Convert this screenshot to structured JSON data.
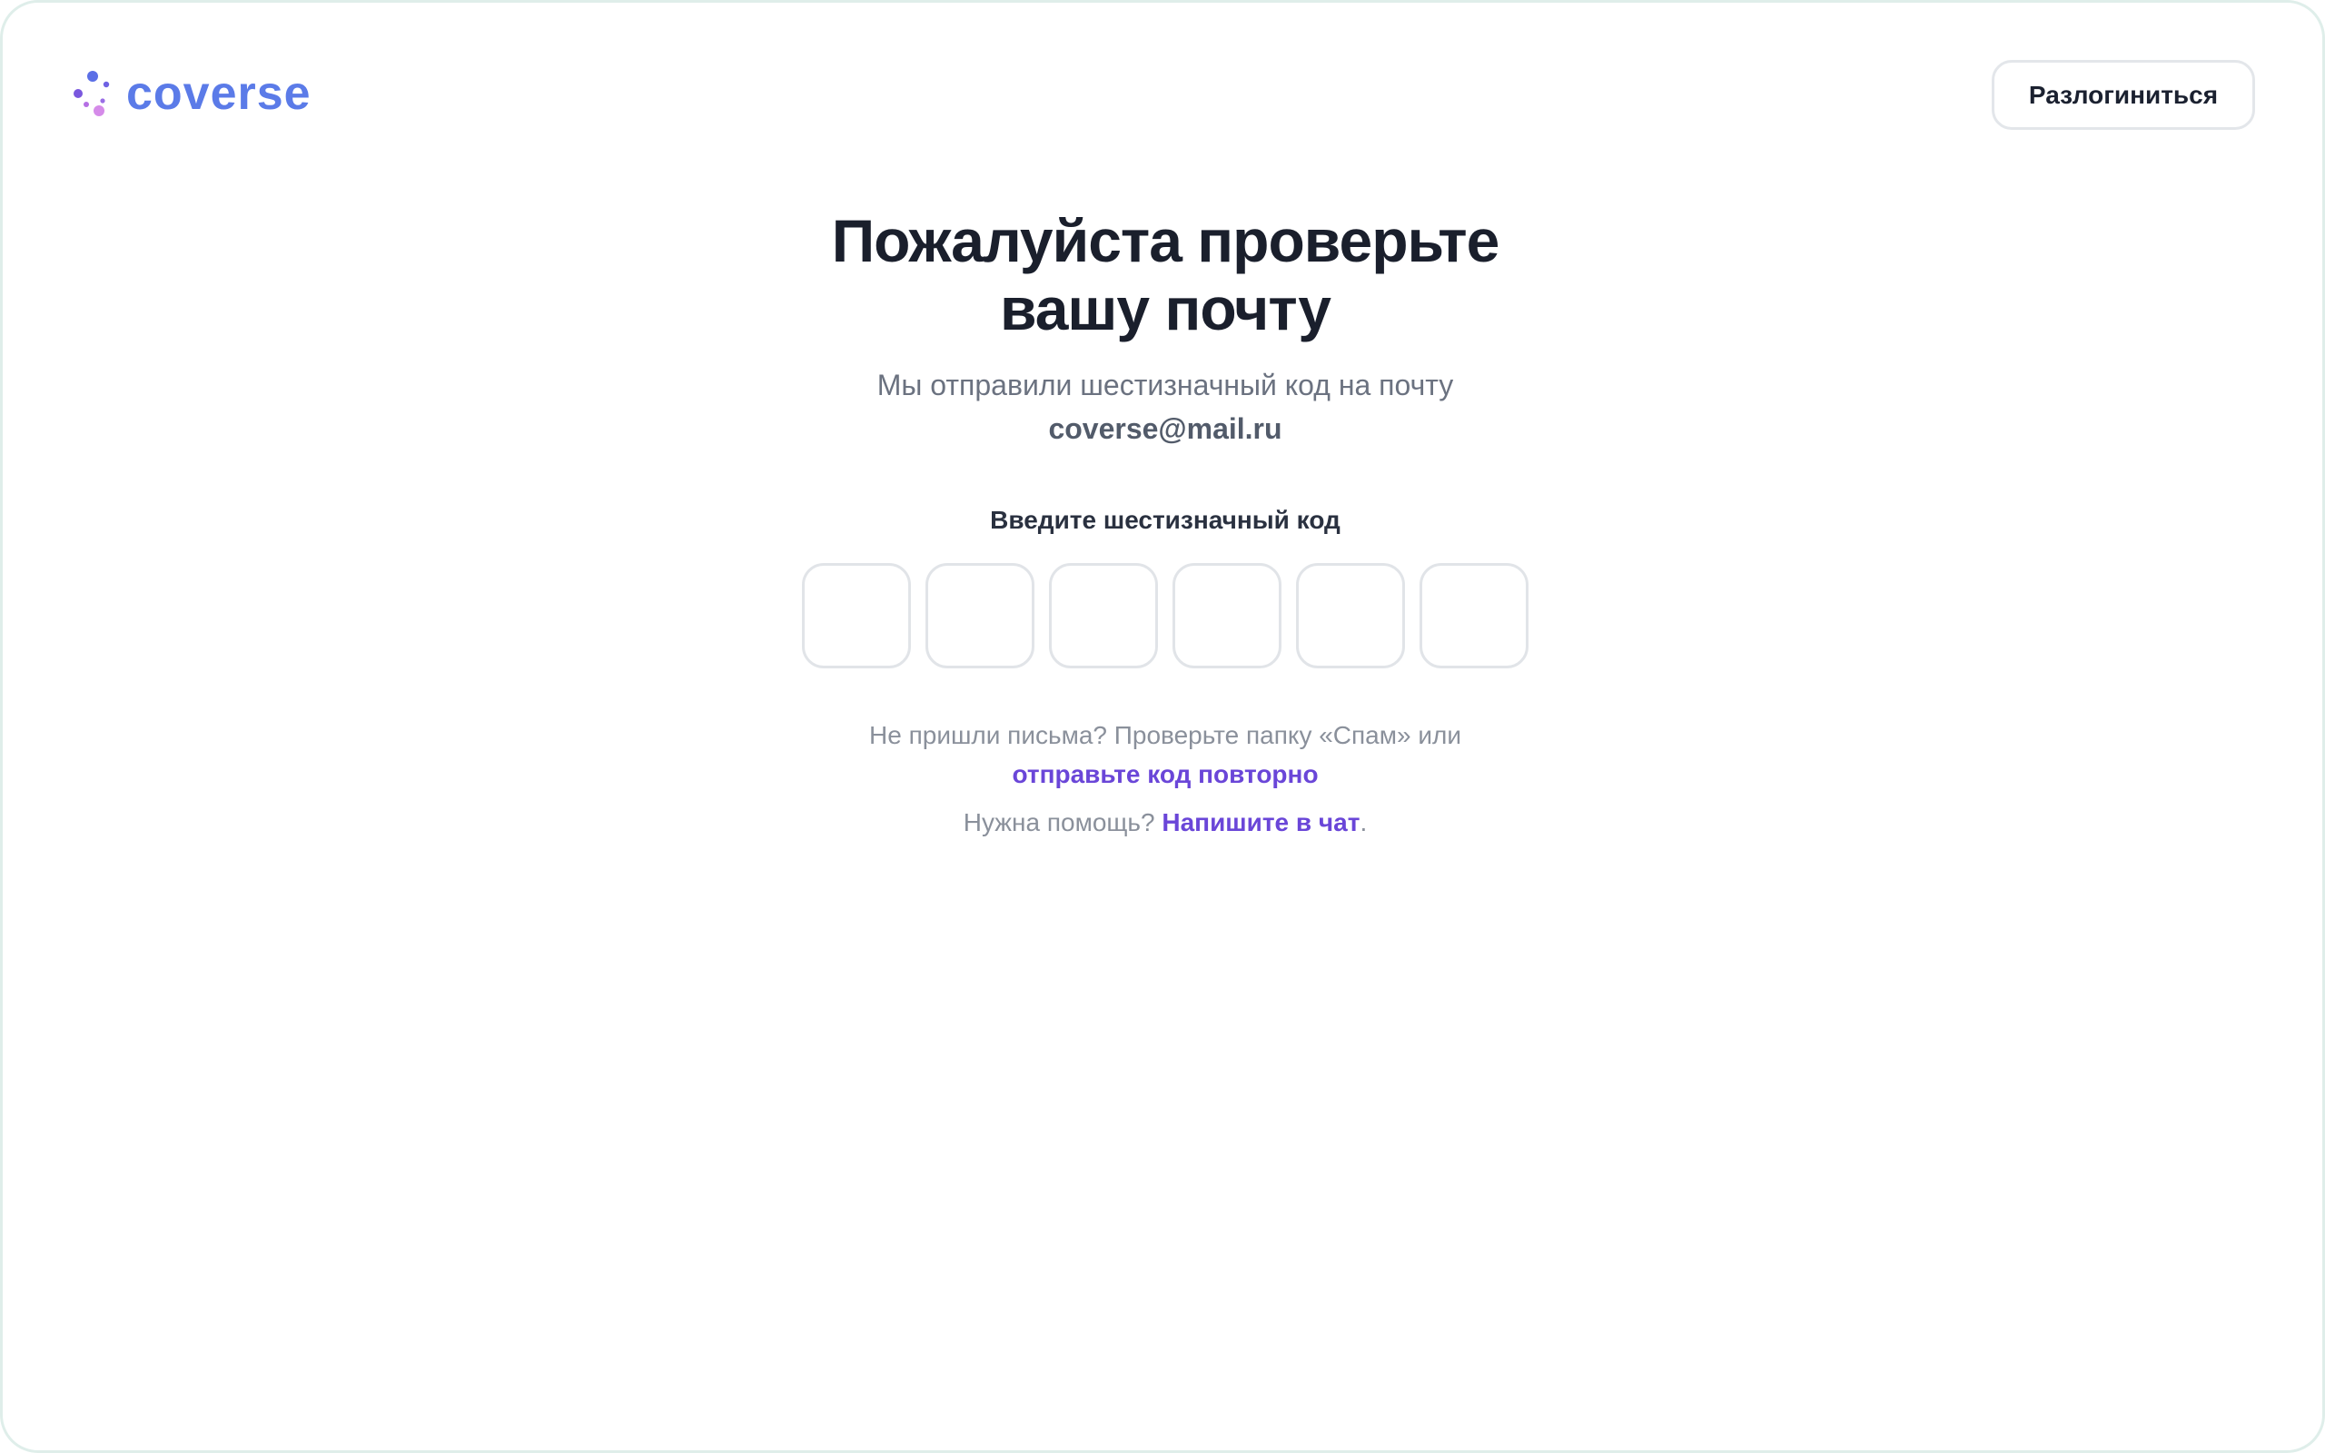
{
  "brand": {
    "name": "coverse",
    "color": "#5b7be8",
    "icon": "dotted-circle-logo-icon"
  },
  "header": {
    "logout_label": "Разлогиниться"
  },
  "main": {
    "title_line1": "Пожалуйста проверьте",
    "title_line2": "вашу почту",
    "subtitle_text": "Мы отправили шестизначный код на почту",
    "email": "coverse@mail.ru",
    "code_label": "Введите шестизначный код",
    "code_digits": [
      "",
      "",
      "",
      "",
      "",
      ""
    ],
    "resend_text": "Не пришли письма? Проверьте папку «Спам» или",
    "resend_link": "отправьте код повторно",
    "help_text": "Нужна помощь?",
    "help_link": "Напишите в чат",
    "help_suffix": "."
  },
  "colors": {
    "accent_link": "#6a46d8",
    "title": "#1a1f2c",
    "muted": "#8a909b"
  }
}
